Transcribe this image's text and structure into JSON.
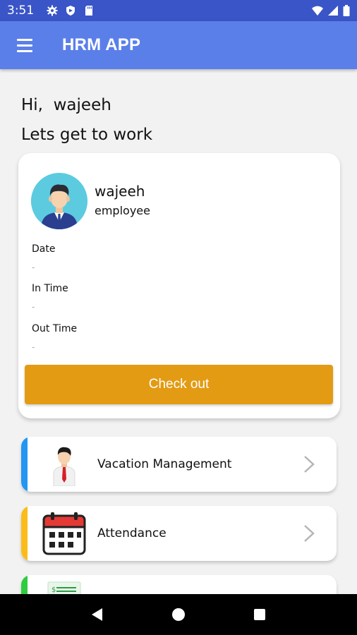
{
  "status_bar": {
    "time": "3:51",
    "left_icons": [
      "gear-icon",
      "shield-icon",
      "sd-card-icon"
    ],
    "right_icons": [
      "wifi-icon",
      "signal-icon",
      "battery-icon"
    ]
  },
  "app_bar": {
    "title": "HRM APP",
    "menu_icon": "hamburger-menu-icon"
  },
  "greeting": {
    "line1": "Hi,  wajeeh",
    "line2": "Lets get to work"
  },
  "profile": {
    "name": "wajeeh",
    "role": "employee",
    "avatar_icon": "employee-avatar-icon",
    "fields": [
      {
        "label": "Date",
        "value": "-"
      },
      {
        "label": "In Time",
        "value": "-"
      },
      {
        "label": "Out Time",
        "value": "-"
      }
    ],
    "action_label": "Check out",
    "action_color": "#e39b13"
  },
  "menu": [
    {
      "label": "Vacation Management",
      "icon": "businessman-icon",
      "accent": "#2196f3"
    },
    {
      "label": "Attendance",
      "icon": "calendar-icon",
      "accent": "#fbbc1a"
    },
    {
      "label": "",
      "icon": "payroll-icon",
      "accent": "#2ecc40"
    }
  ],
  "nav_bar": {
    "buttons": [
      "back-icon",
      "home-icon",
      "recents-icon"
    ]
  },
  "colors": {
    "status_bar": "#3a55c7",
    "app_bar": "#5b7fe9",
    "background": "#f2f2f2"
  }
}
